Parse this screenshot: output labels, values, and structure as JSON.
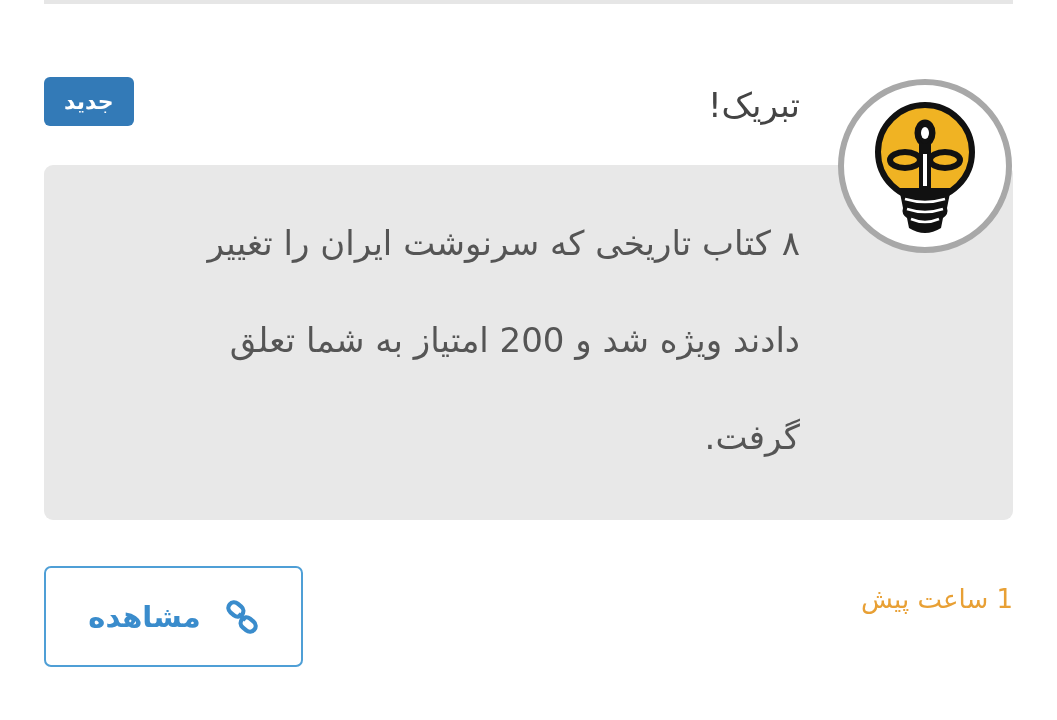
{
  "notification": {
    "title": "تبریک!",
    "badge": "جدید",
    "message": "۸ کتاب تاریخی که سرنوشت ایران را تغییر دادند ویژه شد و 200 امتیاز به شما تعلق گرفت.",
    "time": "1 ساعت پیش",
    "action_button": {
      "label": "مشاهده"
    }
  }
}
